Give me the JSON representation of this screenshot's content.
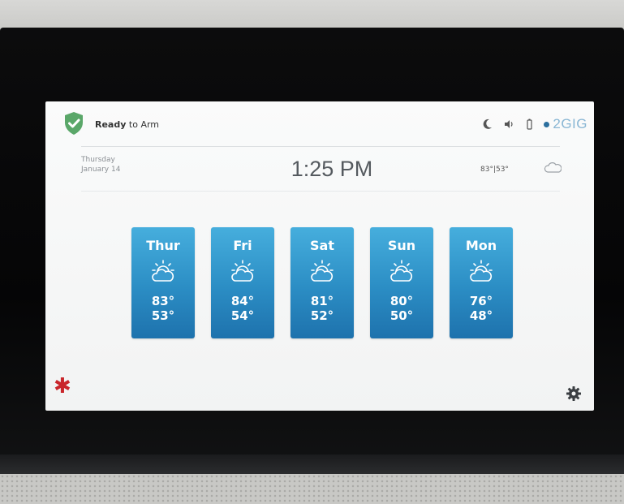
{
  "status": {
    "ready_label": "Ready",
    "arm_label": "to Arm"
  },
  "status_icons": {
    "night_icon": "moon-icon",
    "volume_icon": "speaker-icon",
    "battery_icon": "battery-icon"
  },
  "brand": {
    "name": "2GIG"
  },
  "date": {
    "weekday": "Thursday",
    "month_day": "January 14"
  },
  "time": "1:25 PM",
  "current_weather": {
    "temps": "83°|53°",
    "icon": "partly-cloudy-icon"
  },
  "forecast": [
    {
      "day": "Thur",
      "high": "83°",
      "low": "53°",
      "icon": "partly-cloudy-icon"
    },
    {
      "day": "Fri",
      "high": "84°",
      "low": "54°",
      "icon": "partly-cloudy-icon"
    },
    {
      "day": "Sat",
      "high": "81°",
      "low": "52°",
      "icon": "partly-cloudy-icon"
    },
    {
      "day": "Sun",
      "high": "80°",
      "low": "50°",
      "icon": "partly-cloudy-icon"
    },
    {
      "day": "Mon",
      "high": "76°",
      "low": "48°",
      "icon": "partly-cloudy-icon"
    }
  ],
  "bottom_bar": {
    "emergency_icon": "asterisk-icon",
    "settings_icon": "gear-icon"
  },
  "colors": {
    "shield": "#5aa769",
    "card_top": "#46aedd",
    "card_bottom": "#1e72ad",
    "emergency": "#c9262b",
    "brand": "#89b6d4"
  }
}
